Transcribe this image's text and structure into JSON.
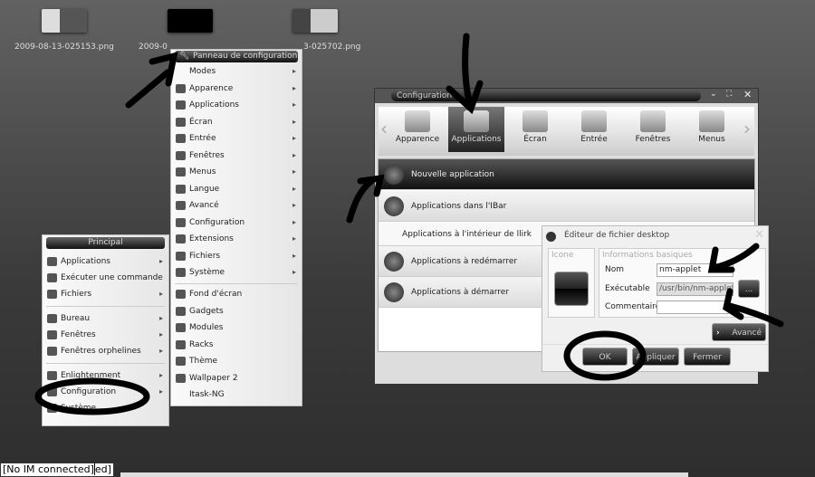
{
  "desktop_icons": [
    {
      "label": "2009-08-13-025153.png"
    },
    {
      "label": "2009-0"
    },
    {
      "label": "3-025702.png"
    }
  ],
  "submenu": {
    "title": "Panneau de configuration",
    "items": [
      {
        "label": "Modes",
        "icon": "none",
        "arrow": true
      },
      {
        "label": "Apparence",
        "icon": "appearance-icon",
        "arrow": true
      },
      {
        "label": "Applications",
        "icon": "play-icon",
        "arrow": true
      },
      {
        "label": "Écran",
        "icon": "monitor-icon",
        "arrow": true
      },
      {
        "label": "Entrée",
        "icon": "keyboard-mouse-icon",
        "arrow": true
      },
      {
        "label": "Fenêtres",
        "icon": "window-icon",
        "arrow": true
      },
      {
        "label": "Menus",
        "icon": "menu-icon",
        "arrow": true
      },
      {
        "label": "Langue",
        "icon": "flag-icon",
        "arrow": true
      },
      {
        "label": "Avancé",
        "icon": "thermometer-icon",
        "arrow": true
      },
      {
        "label": "Configuration",
        "icon": "wrench-icon",
        "arrow": true
      },
      {
        "label": "Extensions",
        "icon": "star-icon",
        "arrow": true
      },
      {
        "label": "Fichiers",
        "icon": "folder-icon",
        "arrow": true
      },
      {
        "label": "Système",
        "icon": "computer-icon",
        "arrow": true
      }
    ],
    "items2": [
      {
        "label": "Fond d'écran",
        "icon": "wallpaper-icon"
      },
      {
        "label": "Gadgets",
        "icon": "gadgets-icon"
      },
      {
        "label": "Modules",
        "icon": "modules-icon"
      },
      {
        "label": "Racks",
        "icon": "racks-icon"
      },
      {
        "label": "Thème",
        "icon": "theme-icon"
      },
      {
        "label": "Wallpaper 2",
        "icon": "wallpaper-icon"
      },
      {
        "label": "Itask-NG",
        "icon": "none"
      }
    ]
  },
  "main_menu": {
    "title": "Principal",
    "group1": [
      {
        "label": "Applications",
        "arrow": true
      },
      {
        "label": "Exécuter une commande",
        "arrow": false
      },
      {
        "label": "Fichiers",
        "arrow": true
      }
    ],
    "group2": [
      {
        "label": "Bureau",
        "arrow": true
      },
      {
        "label": "Fenêtres",
        "arrow": true
      },
      {
        "label": "Fenêtres orphelines",
        "arrow": true
      }
    ],
    "group3": [
      {
        "label": "Enlightenment",
        "arrow": true
      },
      {
        "label": "Configuration",
        "arrow": true
      },
      {
        "label": "Système",
        "arrow": false
      }
    ]
  },
  "config_window": {
    "title": "Configuration",
    "toolbar": [
      {
        "label": "Apparence"
      },
      {
        "label": "Applications",
        "selected": true
      },
      {
        "label": "Écran"
      },
      {
        "label": "Entrée"
      },
      {
        "label": "Fenêtres"
      },
      {
        "label": "Menus"
      }
    ],
    "rows": [
      {
        "label": "Nouvelle application",
        "selected": true
      },
      {
        "label": "Applications dans l'IBar"
      },
      {
        "label": "Applications à l'intérieur de llirk"
      },
      {
        "label": "Applications à redémarrer"
      },
      {
        "label": "Applications à démarrer"
      }
    ]
  },
  "dialog": {
    "title": "Éditeur de fichier desktop",
    "icon_group": "Icone",
    "info_group": "Informations basiques",
    "name_label": "Nom",
    "name_value": "nm-applet",
    "exec_label": "Exécutable",
    "exec_value": "/usr/bin/nm-applet",
    "browse_label": "...",
    "comment_label": "Commentaire",
    "comment_value": "",
    "advanced_label": "Avancé",
    "ok_label": "OK",
    "apply_label": "Appliquer",
    "close_label": "Fermer"
  },
  "statusbar": {
    "text": "[No IM connected]",
    "overflow": "ed]"
  }
}
